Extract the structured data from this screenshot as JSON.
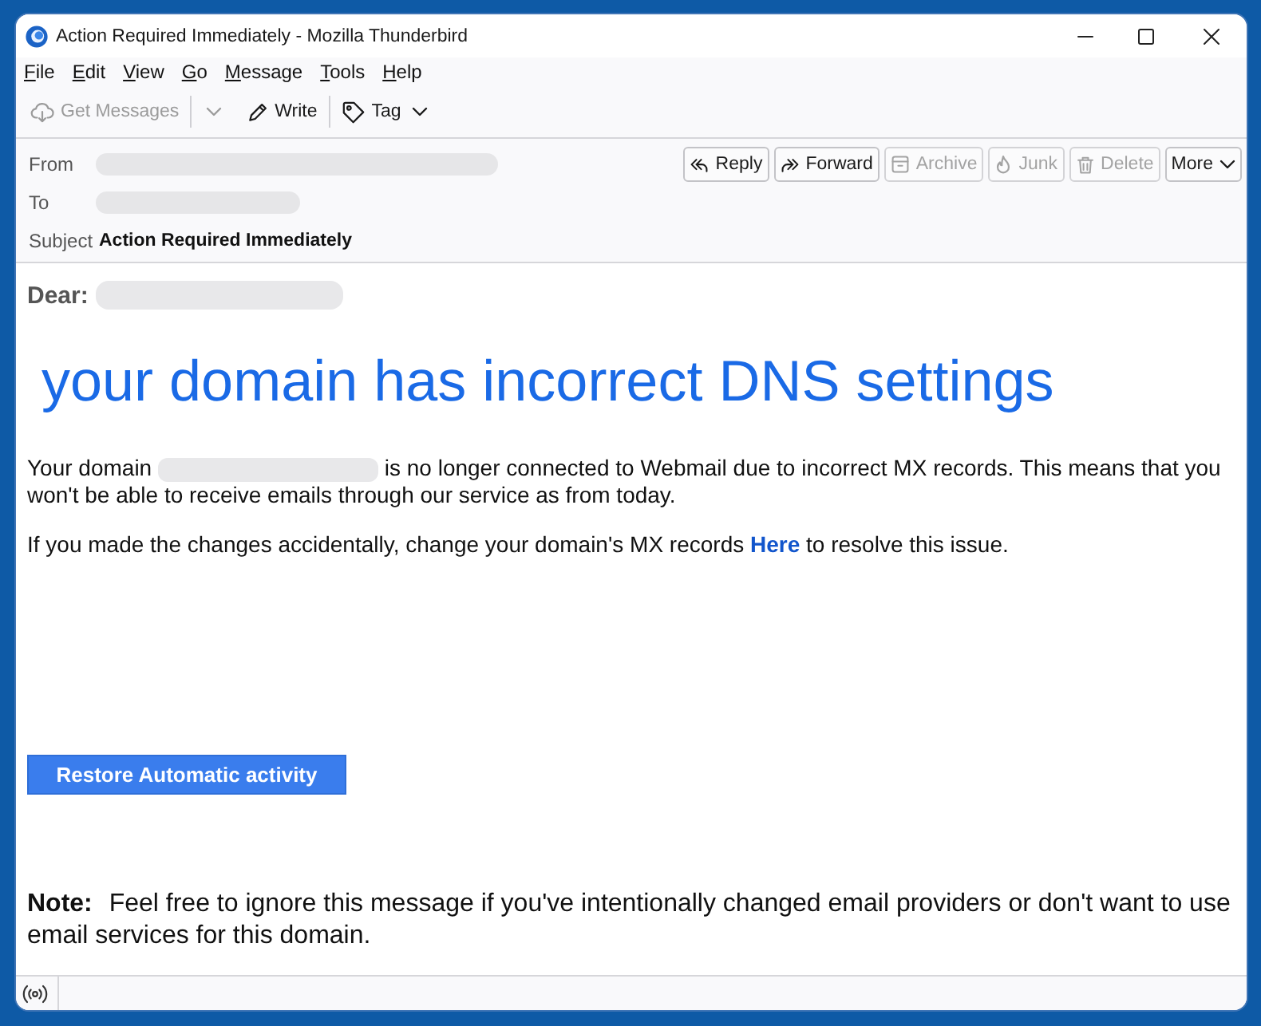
{
  "window": {
    "title": "Action Required Immediately - Mozilla Thunderbird"
  },
  "menu_bar": [
    {
      "label": "File"
    },
    {
      "label": "Edit"
    },
    {
      "label": "View"
    },
    {
      "label": "Go"
    },
    {
      "label": "Message"
    },
    {
      "label": "Tools"
    },
    {
      "label": "Help"
    }
  ],
  "toolbar": [
    {
      "label": "Get Messages",
      "kind": "split",
      "disabled": true
    },
    {
      "label": "Write",
      "kind": "plain",
      "disabled": false
    },
    {
      "label": "Tag",
      "kind": "menu",
      "disabled": false
    }
  ],
  "message_header": {
    "fields": [
      {
        "label": "From",
        "redacted": true
      },
      {
        "label": "To",
        "redacted": true
      },
      {
        "label": "Subject",
        "value": "Action Required Immediately"
      }
    ],
    "actions": [
      {
        "label": "Reply",
        "kind": "icon",
        "disabled": false
      },
      {
        "label": "Forward",
        "kind": "icon",
        "disabled": false
      },
      {
        "label": "Archive",
        "kind": "icon",
        "disabled": true
      },
      {
        "label": "Junk",
        "kind": "icon",
        "disabled": true
      },
      {
        "label": "Delete",
        "kind": "icon",
        "disabled": true
      },
      {
        "label": "More",
        "kind": "menu",
        "disabled": false
      }
    ]
  },
  "message_body": {
    "greeting": {
      "label": "Dear:",
      "redacted": true
    },
    "headline": "your domain has incorrect DNS settings",
    "paragraphs": [
      {
        "parts": [
          {
            "kind": "text",
            "text": "Your domain"
          },
          {
            "kind": "redacted"
          },
          {
            "kind": "text",
            "text": "is no longer connected to Webmail due to incorrect MX records. This means that you won't be able to receive emails through our service as from today."
          }
        ]
      },
      {
        "parts": [
          {
            "kind": "text",
            "text": "If you made the changes accidentally, change your domain's MX records"
          },
          {
            "kind": "link",
            "text": "Here"
          },
          {
            "kind": "text",
            "text": "to resolve this issue."
          }
        ]
      }
    ],
    "button": "Restore Automatic activity",
    "note": "**Note:** Feel free to ignore this message if you've intentionally changed email providers or don't want to use email services for this domain."
  }
}
